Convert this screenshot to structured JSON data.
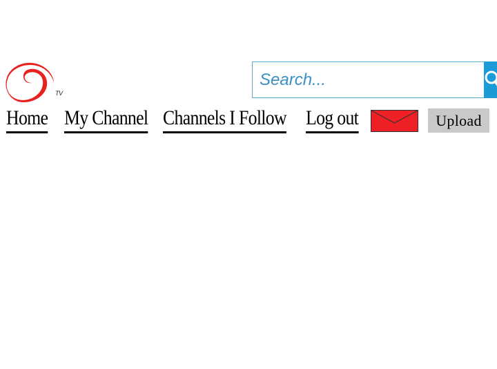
{
  "logo": {
    "text": "TV",
    "color": "#e8231f"
  },
  "search": {
    "placeholder": "Search...",
    "button_icon": "search-icon",
    "button_color": "#1a9ad6"
  },
  "nav": {
    "items": [
      {
        "label": "Home"
      },
      {
        "label": "My Channel"
      },
      {
        "label": "Channels I Follow"
      },
      {
        "label": "Log out"
      }
    ]
  },
  "messages": {
    "icon": "envelope-icon",
    "color": "#ee1f25"
  },
  "upload": {
    "label": "Upload"
  }
}
